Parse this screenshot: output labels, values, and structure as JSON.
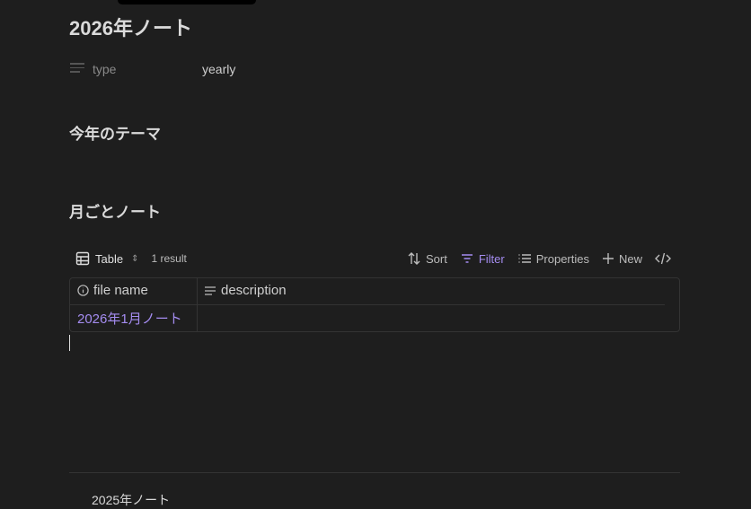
{
  "title": "2026年ノート",
  "properties": [
    {
      "key": "type",
      "value": "yearly",
      "icon": "text-lines-icon"
    }
  ],
  "headings": [
    "今年のテーマ",
    "月ごとノート"
  ],
  "base": {
    "view_label": "Table",
    "result_count": "1 result",
    "actions": {
      "sort": "Sort",
      "filter": "Filter",
      "properties": "Properties",
      "new": "New"
    },
    "columns": [
      {
        "label": "file name",
        "icon": "info-icon"
      },
      {
        "label": "description",
        "icon": "text-lines-icon"
      }
    ],
    "rows": [
      {
        "file_name": "2026年1月ノート",
        "description": ""
      }
    ]
  },
  "footer_link": "2025年ノート",
  "colors": {
    "accent": "#a48cf0",
    "background": "#1e1e1e"
  }
}
